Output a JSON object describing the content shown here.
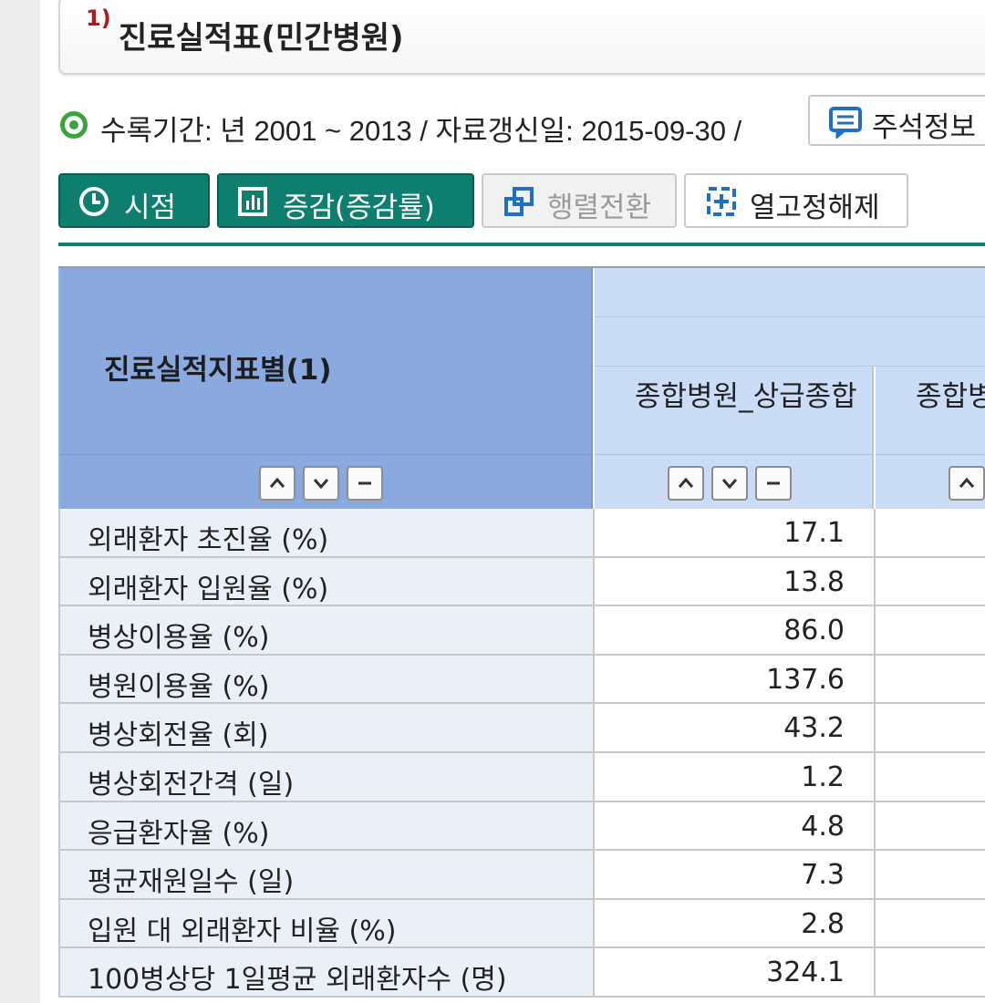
{
  "title": {
    "number": "1)",
    "text": "진료실적표(민간병원)"
  },
  "info": {
    "period_text": "수록기간: 년 2001 ~ 2013 / 자료갱신일: 2015-09-30 /",
    "note_label": "주석정보"
  },
  "toolbar": {
    "time_label": "시점",
    "change_label": "증감(증감률)",
    "pivot_label": "행렬전환",
    "unfreeze_label": "열고정해제"
  },
  "table": {
    "row_header_title": "진료실적지표별(1)",
    "columns": [
      "종합병원_상급종합",
      "종합병원_상이상"
    ],
    "rows": [
      {
        "label": "외래환자 초진율 (%)",
        "value": "17.1"
      },
      {
        "label": "외래환자 입원율 (%)",
        "value": "13.8"
      },
      {
        "label": "병상이용율 (%)",
        "value": "86.0"
      },
      {
        "label": "병원이용율 (%)",
        "value": "137.6"
      },
      {
        "label": "병상회전율 (회)",
        "value": "43.2"
      },
      {
        "label": "병상회전간격 (일)",
        "value": "1.2"
      },
      {
        "label": "응급환자율 (%)",
        "value": "4.8"
      },
      {
        "label": "평균재원일수 (일)",
        "value": "7.3"
      },
      {
        "label": "입원 대 외래환자 비율 (%)",
        "value": "2.8"
      },
      {
        "label": "100병상당 1일평균 외래환자수 (명)",
        "value": "324.1"
      }
    ]
  },
  "colors": {
    "accent": "#0e7f6f",
    "header_dark": "#8aa9de",
    "header_light": "#cbdcf6",
    "row_label_bg": "#eaf0f8",
    "title_number": "#b0171f",
    "radio": "#3aa43a",
    "icon_blue": "#1f6fc5"
  },
  "icons": {
    "radio": "radio-selected-icon",
    "note": "comment-icon",
    "time": "clock-icon",
    "change": "bar-chart-icon",
    "pivot": "pivot-icon",
    "unfreeze": "unfreeze-icon",
    "sort_up": "chevron-up-icon",
    "sort_down": "chevron-down-icon",
    "sort_reset": "minus-icon"
  }
}
